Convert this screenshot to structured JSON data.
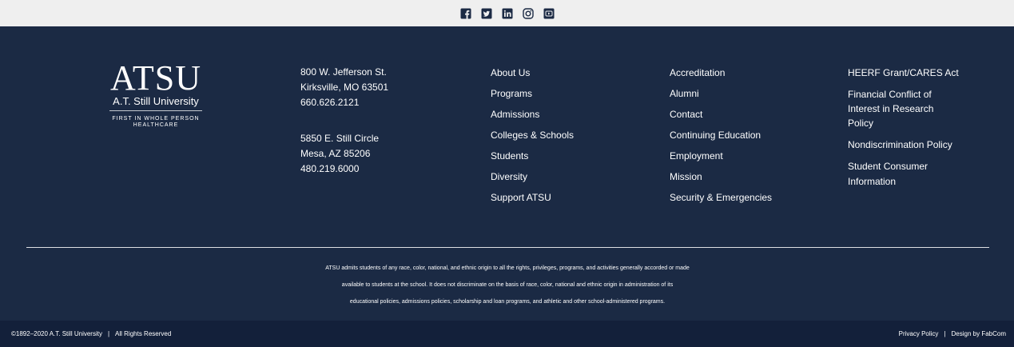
{
  "social": {
    "icons": [
      "facebook-icon",
      "twitter-icon",
      "linkedin-icon",
      "instagram-icon",
      "youtube-icon"
    ],
    "icon_color": "#1b2a44",
    "bar_color": "#efefef"
  },
  "logo": {
    "mark": "ATSU",
    "name": "A.T. Still University",
    "tagline_1": "FIRST IN WHOLE PERSON",
    "tagline_2": "HEALTHCARE"
  },
  "address": {
    "kirksville": [
      "800 W. Jefferson St.",
      "Kirksville, MO 63501",
      "660.626.2121"
    ],
    "mesa": [
      "5850 E. Still Circle",
      "Mesa, AZ 85206",
      "480.219.6000"
    ]
  },
  "links_col1": [
    "About Us",
    "Programs",
    "Admissions",
    "Colleges & Schools",
    "Students",
    "Diversity",
    "Support ATSU"
  ],
  "links_col2": [
    "Accreditation",
    "Alumni",
    "Contact",
    "Continuing Education",
    "Employment",
    "Mission",
    "Security & Emergencies"
  ],
  "links_col3": [
    "HEERF Grant/CARES Act",
    "Financial Conflict of Interest in Research Policy",
    "Nondiscrimination Policy",
    "Student Consumer Information"
  ],
  "notice": {
    "line_1": "ATSU admits students of any race, color, national, and ethnic origin to all the rights, privileges, programs, and activities generally accorded or made",
    "line_2": "available to students at the school. It does not discriminate on the basis of race, color, national and ethnic origin in administration of its",
    "line_3": "educational policies, admissions policies, scholarship and loan programs, and athletic and other school-administered programs."
  },
  "bottom": {
    "copyright": "©1892–2020 A.T. Still University",
    "separator": "|",
    "rights": "All Rights Reserved",
    "privacy": "Privacy Policy",
    "design": "Design by FabCom"
  },
  "colors": {
    "footer_bg": "#1b2a44",
    "bottom_bg": "#13203a"
  }
}
